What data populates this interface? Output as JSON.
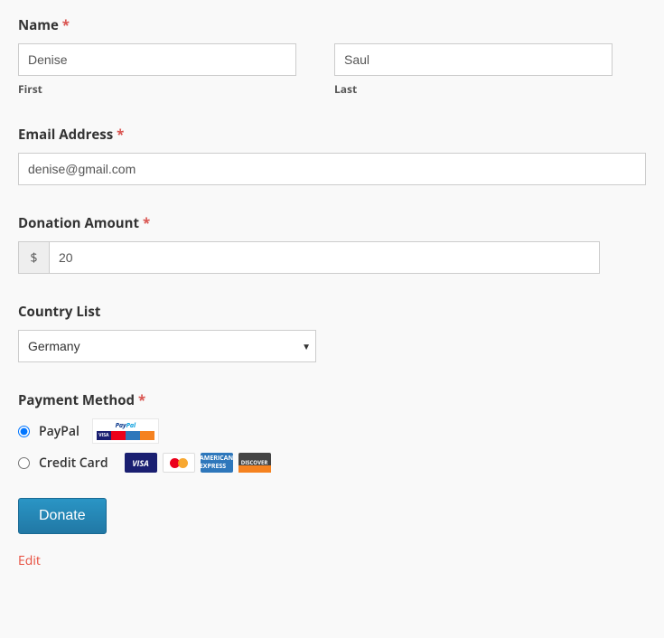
{
  "name": {
    "label": "Name",
    "first_value": "Denise",
    "first_sub": "First",
    "last_value": "Saul",
    "last_sub": "Last"
  },
  "email": {
    "label": "Email Address",
    "value": "denise@gmail.com"
  },
  "amount": {
    "label": "Donation Amount",
    "currency": "$",
    "value": "20"
  },
  "country": {
    "label": "Country List",
    "value": "Germany"
  },
  "payment": {
    "label": "Payment Method",
    "option_paypal": "PayPal",
    "option_cc": "Credit Card",
    "selected": "paypal"
  },
  "submit": "Donate",
  "edit": "Edit",
  "required": "*",
  "paypal_logo": {
    "pay": "Pay",
    "pal": "Pal"
  }
}
